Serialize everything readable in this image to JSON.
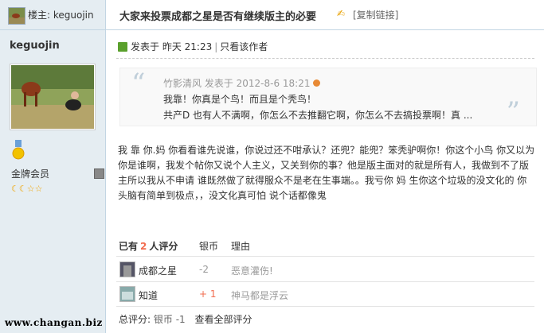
{
  "floor": {
    "label": "楼主: keguojin"
  },
  "author": {
    "name": "keguojin",
    "group": "金牌会员",
    "stars": "☾☾☆☆"
  },
  "thread": {
    "title": "大家来投票成都之星是否有继续版主的必要",
    "copy_link": "[复制链接]"
  },
  "post": {
    "posted_label": "发表于 昨天 21:23",
    "only_author": "只看该作者",
    "quote": {
      "author_line": "竹影清风 发表于 2012-8-6 18:21",
      "line1": "我靠！你真是个鸟！而且是个秃鸟！",
      "line2": "共产D  也有人不满啊，你怎么不去推翻它啊，你怎么不去搞投票啊！真 ..."
    },
    "body": "我  靠  你.妈  你看看谁先说谁，你说过还不咁承认？还兜？能兜？笨秃驴啊你！你这个小鸟 你又以为你是谁啊，我发个帖你又说个人主义，又关到你的事？他是版主面对的就是所有人，我做到不了版主所以我从不申请 谁既然做了就得服众不是老在生事端。。我亏你 妈  生你这个垃圾的没文化的  你头脑有简单到极点，，没文化真可怕 说个话都像鬼"
  },
  "rating": {
    "header_prefix": "已有",
    "count": "2",
    "header_suffix": "人评分",
    "col_coin": "银币",
    "col_reason": "理由",
    "rows": [
      {
        "name": "成都之星",
        "score": "-2",
        "reason": "恶意灌伤!"
      },
      {
        "name": "知道",
        "score": "+ 1",
        "reason": "神马都是浮云"
      }
    ],
    "total_label": "总评分:",
    "total_value": "银币 -1",
    "view_all": "查看全部评分"
  },
  "watermark": "www.changan.biz",
  "colors": {
    "accent": "#f26c4f",
    "sidebar_bg": "#e5edf2",
    "border": "#c2d5e3"
  }
}
